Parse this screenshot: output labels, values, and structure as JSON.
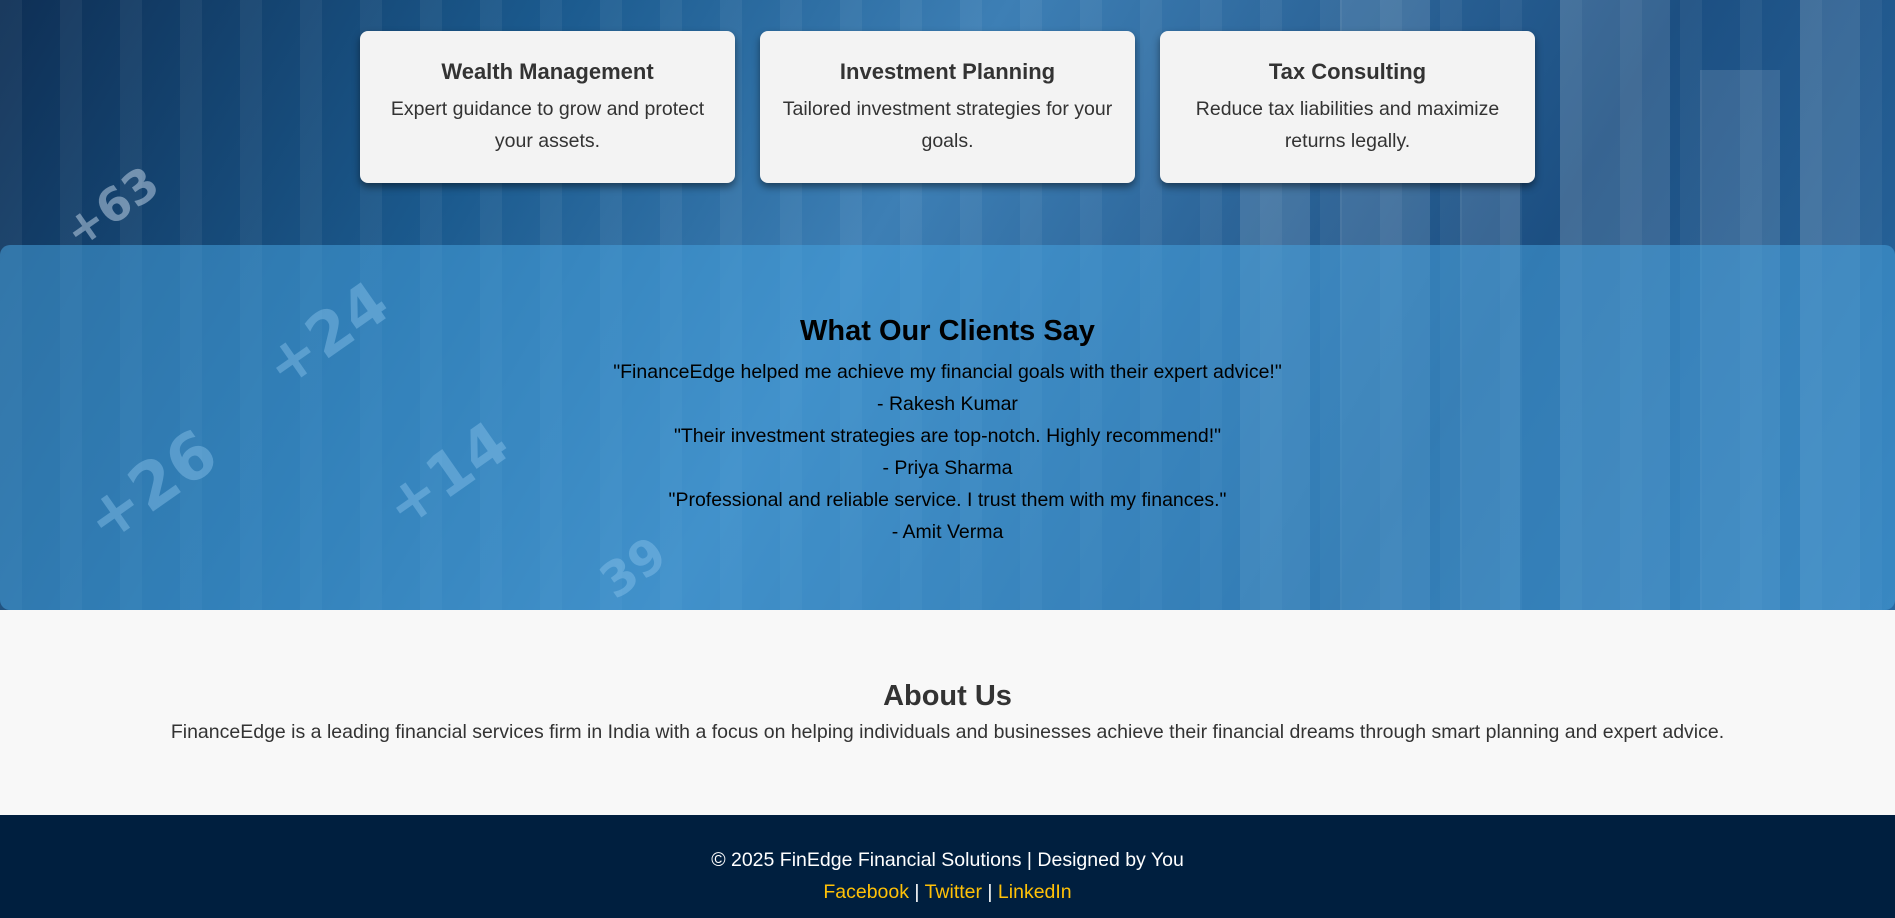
{
  "services": [
    {
      "title": "Wealth Management",
      "description": "Expert guidance to grow and protect your assets."
    },
    {
      "title": "Investment Planning",
      "description": "Tailored investment strategies for your goals."
    },
    {
      "title": "Tax Consulting",
      "description": "Reduce tax liabilities and maximize returns legally."
    }
  ],
  "testimonials": {
    "heading": "What Our Clients Say",
    "items": [
      {
        "quote": "\"FinanceEdge helped me achieve my financial goals with their expert advice!\"",
        "author": "- Rakesh Kumar"
      },
      {
        "quote": "\"Their investment strategies are top-notch. Highly recommend!\"",
        "author": "- Priya Sharma"
      },
      {
        "quote": "\"Professional and reliable service. I trust them with my finances.\"",
        "author": "- Amit Verma"
      }
    ]
  },
  "about": {
    "heading": "About Us",
    "text": "FinanceEdge is a leading financial services firm in India with a focus on helping individuals and businesses achieve their financial dreams through smart planning and expert advice."
  },
  "footer": {
    "copyright": "© 2025 FinEdge Financial Solutions | Designed by You",
    "links": [
      "Facebook",
      "Twitter",
      "LinkedIn"
    ],
    "separator": "|",
    "link_color": "#ffc107",
    "background": "#001f3f"
  }
}
